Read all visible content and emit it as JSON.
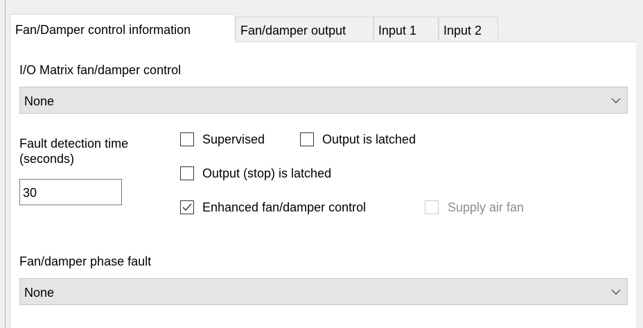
{
  "tabs": [
    {
      "label": "Fan/Damper control information",
      "active": true
    },
    {
      "label": "Fan/damper output",
      "active": false
    },
    {
      "label": "Input 1",
      "active": false
    },
    {
      "label": "Input 2",
      "active": false
    }
  ],
  "io_matrix": {
    "label": "I/O Matrix fan/damper control",
    "value": "None"
  },
  "fault_detection": {
    "label_line1": "Fault detection time",
    "label_line2": "(seconds)",
    "value": "30"
  },
  "checkboxes": {
    "supervised": {
      "label": "Supervised",
      "checked": false
    },
    "output_latched": {
      "label": "Output is latched",
      "checked": false
    },
    "output_stop_latched": {
      "label": "Output (stop) is latched",
      "checked": false
    },
    "enhanced": {
      "label": "Enhanced fan/damper control",
      "checked": true
    },
    "supply_air_fan": {
      "label": "Supply air fan",
      "checked": false,
      "disabled": true
    }
  },
  "phase_fault": {
    "label": "Fan/damper phase fault",
    "value": "None"
  }
}
